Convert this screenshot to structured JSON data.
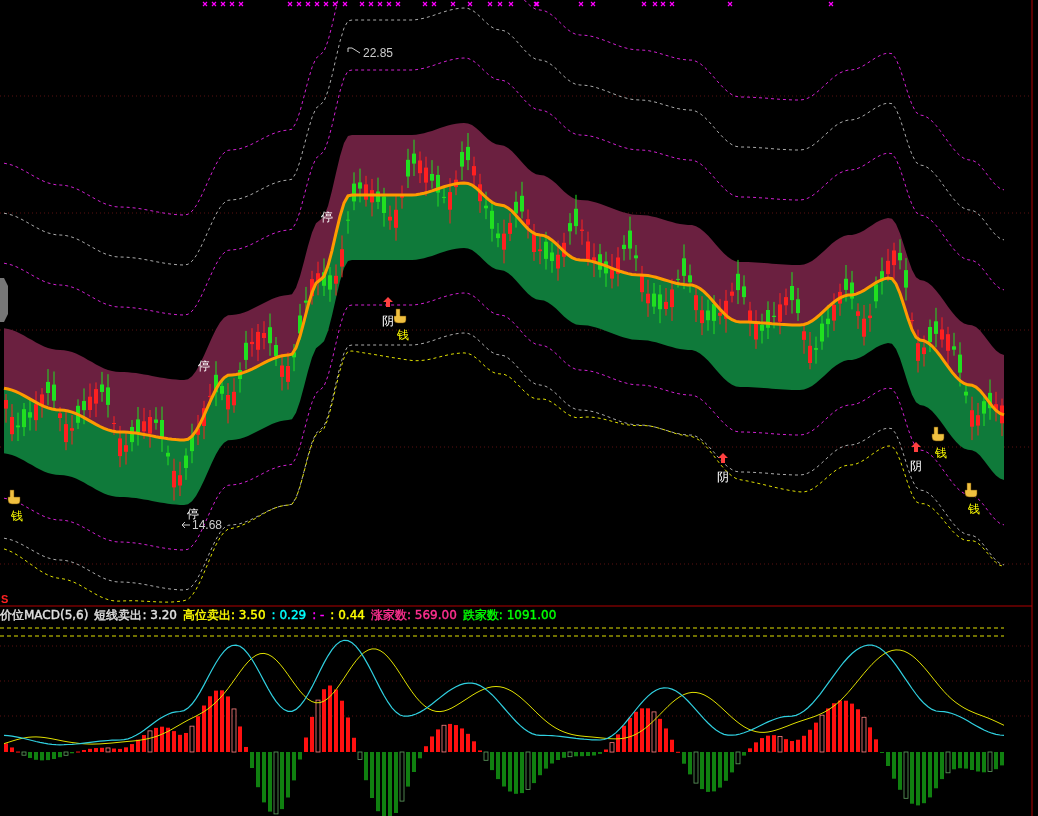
{
  "price_chart": {
    "high_label": "22.85",
    "low_label": "14.68",
    "signals": [
      {
        "kind": "stop",
        "text": "停"
      },
      {
        "kind": "stop",
        "text": "停"
      },
      {
        "kind": "stop",
        "text": "停"
      },
      {
        "kind": "yin",
        "text": "阴"
      },
      {
        "kind": "yin",
        "text": "阴"
      },
      {
        "kind": "yin",
        "text": "阴"
      },
      {
        "kind": "money",
        "text": "钱"
      },
      {
        "kind": "money",
        "text": "钱"
      },
      {
        "kind": "money",
        "text": "钱"
      },
      {
        "kind": "money",
        "text": "钱"
      }
    ],
    "sell_mark": "S"
  },
  "indicator_legend": [
    {
      "text": "价位MACD(5,6)",
      "color": "#e0e0e0"
    },
    {
      "text": "短线卖出: 3.20",
      "color": "#e0e0e0"
    },
    {
      "text": "高位卖出: 3.50",
      "color": "#ffff00"
    },
    {
      "text": ": 0.29",
      "color": "#00ffff"
    },
    {
      "text": ": -",
      "color": "#ff00ff"
    },
    {
      "text": ": 0.44",
      "color": "#ffff00"
    },
    {
      "text": "涨家数: 569.00",
      "color": "#ff3090"
    },
    {
      "text": "跌家数: 1091.00",
      "color": "#00ff00"
    }
  ]
}
